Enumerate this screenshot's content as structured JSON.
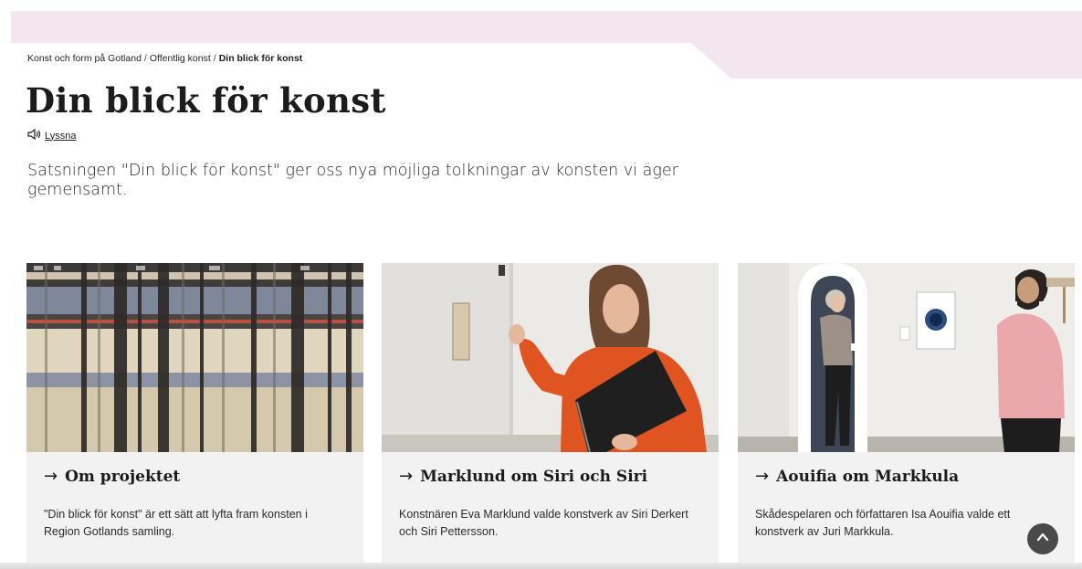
{
  "breadcrumb": {
    "items": [
      "Konst och form på Gotland",
      "Offentlig konst"
    ],
    "separator": "/",
    "current": "Din blick för konst"
  },
  "page": {
    "title": "Din blick för konst",
    "listen_label": "Lyssna",
    "lead": "Satsningen \"Din blick för konst\" ger oss nya möjliga tolkningar av konsten vi äger gemensamt."
  },
  "cards": [
    {
      "arrow": "→",
      "title": "Om projektet",
      "text": "\"Din blick för konst\" är ett sätt att lyfta fram konsten i Region Gotlands samling.",
      "image": "woven-textile-photo"
    },
    {
      "arrow": "→",
      "title": "Marklund om Siri och Siri",
      "text": "Konstnären Eva Marklund valde konstverk av Siri Derkert och Siri Pettersson.",
      "image": "woman-in-orange-jacket-photo"
    },
    {
      "arrow": "→",
      "title": "Aouifia om Markkula",
      "text": "Skådespelaren och författaren Isa Aouifia valde ett konstverk av Juri Markkula.",
      "image": "two-people-in-gallery-photo"
    }
  ],
  "colors": {
    "band": "#f4e6ee",
    "card_bg": "#f2f2f2",
    "orange_jacket": "#e0541f",
    "scroll_button": "#4a4a4a"
  },
  "icons": {
    "listen": "speaker-icon",
    "scroll_top": "chevron-up-icon"
  }
}
